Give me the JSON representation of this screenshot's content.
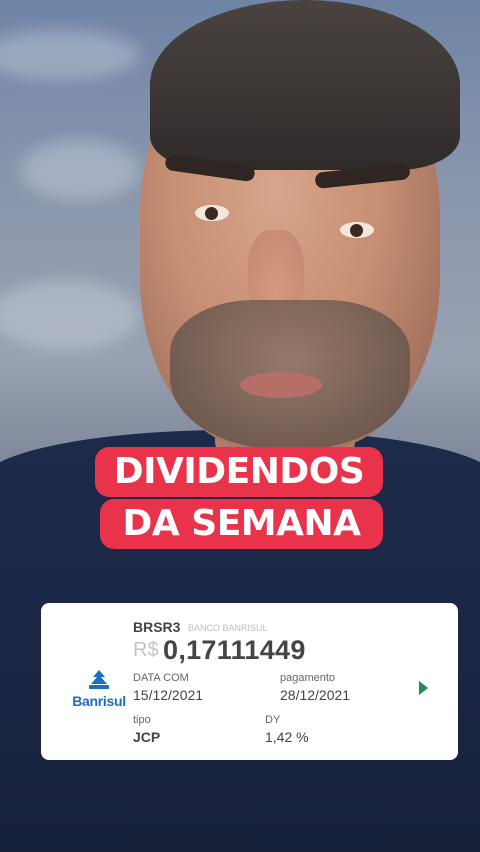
{
  "overlay": {
    "title_line1": "DIVIDENDOS",
    "title_line2": "DA SEMANA"
  },
  "card": {
    "ticker": "BRSR3",
    "company": "BANCO BANRISUL",
    "currency": "R$",
    "amount": "0,17111449",
    "logo_text": "Banrisul",
    "data_com_label": "DATA COM",
    "data_com_value": "15/12/2021",
    "pagamento_label": "pagamento",
    "pagamento_value": "28/12/2021",
    "tipo_label": "tipo",
    "tipo_value": "JCP",
    "dy_label": "DY",
    "dy_value": "1,42 %",
    "arrow_icon": "play-arrow-icon"
  },
  "colors": {
    "title_pill": "#e8334a",
    "banrisul_blue": "#1b6fbf",
    "arrow_green": "#1e8f4e"
  }
}
